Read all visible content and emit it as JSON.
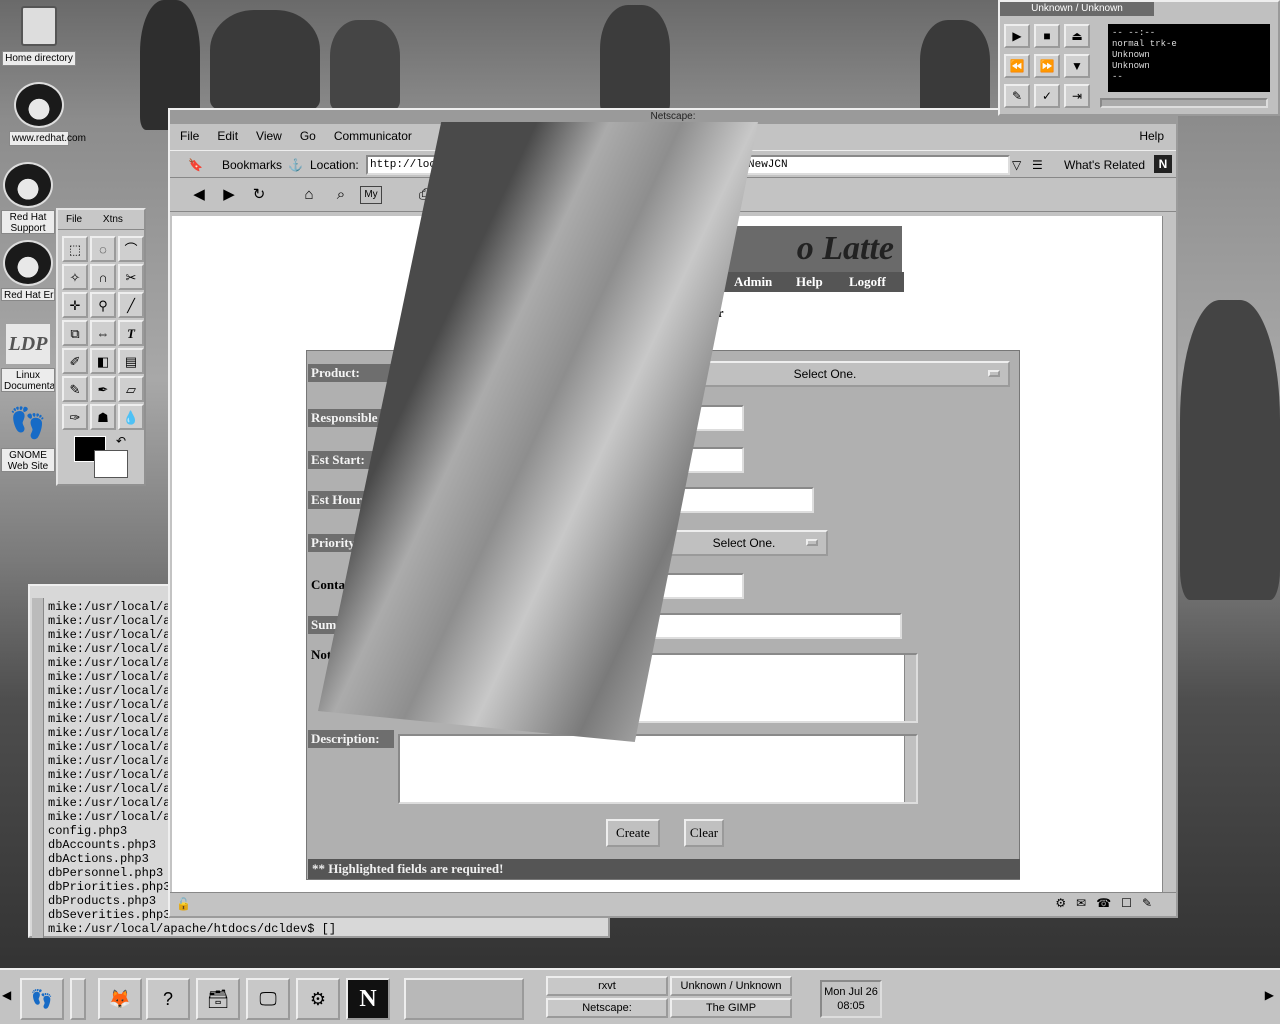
{
  "desktop": {
    "icons": [
      {
        "label": "Home directory"
      },
      {
        "label": "www.redhat.com"
      },
      {
        "label": "Red Hat Support"
      },
      {
        "label": "Red Hat Errata"
      },
      {
        "label": "Linux Documentation"
      },
      {
        "label": "GNOME Web Site"
      }
    ]
  },
  "media_player": {
    "title": "Unknown / Unknown",
    "display_line1": "--  --:--",
    "display_line2": "normal  trk-e",
    "display_line3": "Unknown",
    "display_line4": "Unknown",
    "display_line5": "--"
  },
  "gimp": {
    "menu_file": "File",
    "menu_xtns": "Xtns"
  },
  "terminal": {
    "lines": [
      "mike:/usr/local/a",
      "mike:/usr/local/a",
      "mike:/usr/local/a",
      "mike:/usr/local/a",
      "mike:/usr/local/a",
      "mike:/usr/local/a",
      "mike:/usr/local/a",
      "mike:/usr/local/a",
      "mike:/usr/local/a",
      "mike:/usr/local/a",
      "mike:/usr/local/a",
      "mike:/usr/local/a",
      "mike:/usr/local/a",
      "mike:/usr/local/a",
      "mike:/usr/local/a",
      "mike:/usr/local/a",
      "config.php3",
      "dbAccounts.php3",
      "dbActions.php3",
      "dbPersonnel.php3",
      "dbPriorities.php3",
      "dbProducts.php3",
      "dbSeverities.php3"
    ],
    "prompt": "mike:/usr/local/apache/htdocs/dcldev$ []"
  },
  "netscape": {
    "title": "Netscape:",
    "menu": {
      "file": "File",
      "edit": "Edit",
      "view": "View",
      "go": "Go",
      "communicator": "Communicator",
      "help": "Help"
    },
    "bookmarks": "Bookmarks",
    "location_label": "Location:",
    "url_left": "http://loc",
    "url_right": "NewJCN",
    "whats_related": "What's Related",
    "page": {
      "logo_text": "o Latte",
      "nav": {
        "admin": "Admin",
        "help": "Help",
        "logoff": "Logoff"
      },
      "heading_fragment": "er",
      "form": {
        "product_label": "Product:",
        "product_select": "Select One.",
        "responsible_label": "Responsible",
        "est_start_label": "Est Start:",
        "est_hours_label": "Est Hour",
        "priority_label": "Priority",
        "priority_select": "Select One.",
        "contact_label": "Contac",
        "summary_label": "Sum",
        "notes_label": "Note",
        "description_label": "Description:",
        "create_button": "Create",
        "clear_button": "Clear",
        "footer_note": "** Highlighted fields are required!"
      }
    }
  },
  "panel": {
    "tasks": [
      "rxvt",
      "Unknown / Unknown",
      "Netscape:",
      "The GIMP"
    ],
    "clock_date": "Mon Jul 26",
    "clock_time": "08:05"
  }
}
